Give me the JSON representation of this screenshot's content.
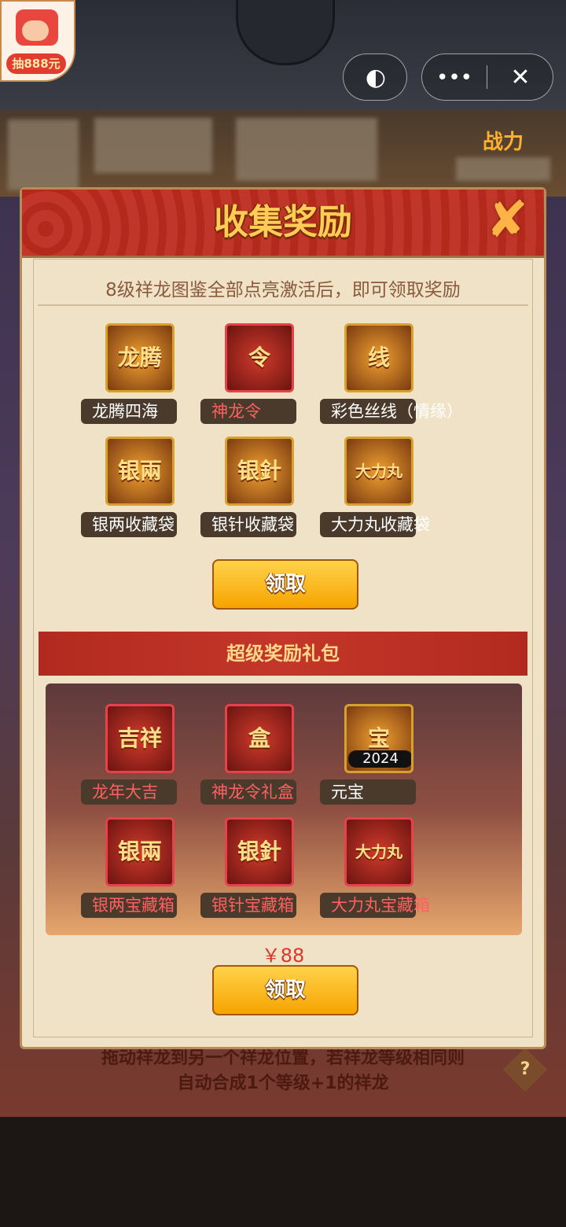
{
  "promo": {
    "label": "抽888元",
    "icon": "gift-hand-icon"
  },
  "capsule": {
    "share_icon": "game-share-icon",
    "more_icon": "more-dots-icon",
    "close_icon": "close-icon"
  },
  "dialog": {
    "title": "收集奖励",
    "close_icon": "dialog-close-x-icon",
    "description": "8级祥龙图鉴全部点亮激活后，即可领取奖励",
    "collect_rewards": [
      {
        "label": "龙腾四海",
        "glyph": "龙腾",
        "frame": "gold",
        "label_color": "white"
      },
      {
        "label": "神龙令",
        "glyph": "令",
        "frame": "red",
        "label_color": "red"
      },
      {
        "label": "彩色丝线（情缘）",
        "glyph": "线",
        "frame": "gold",
        "label_color": "white"
      },
      {
        "label": "银两收藏袋",
        "glyph": "银兩",
        "frame": "gold",
        "label_color": "white"
      },
      {
        "label": "银针收藏袋",
        "glyph": "银針",
        "frame": "gold",
        "label_color": "white"
      },
      {
        "label": "大力丸收藏袋",
        "glyph": "大力丸",
        "frame": "gold",
        "label_color": "white"
      }
    ],
    "claim_button_1": "领取",
    "super_title": "超级奖励礼包",
    "super_rewards": [
      {
        "label": "龙年大吉",
        "glyph": "吉祥",
        "frame": "red",
        "label_color": "red"
      },
      {
        "label": "神龙令礼盒",
        "glyph": "盒",
        "frame": "red",
        "label_color": "red"
      },
      {
        "label": "元宝",
        "glyph": "宝",
        "frame": "gold",
        "label_color": "white",
        "badge": "2024"
      },
      {
        "label": "银两宝藏箱",
        "glyph": "银兩",
        "frame": "red",
        "label_color": "red"
      },
      {
        "label": "银针宝藏箱",
        "glyph": "银針",
        "frame": "red",
        "label_color": "red"
      },
      {
        "label": "大力丸宝藏箱",
        "glyph": "大力丸",
        "frame": "red",
        "label_color": "red"
      }
    ],
    "price": "￥88",
    "claim_button_2": "领取"
  },
  "background": {
    "power_label": "战力",
    "hint_line1": "拖动祥龙到另一个祥龙位置，若祥龙等级相同则",
    "hint_line2": "自动合成1个等级+1的祥龙"
  },
  "colors": {
    "accent_gold": "#ffcd55",
    "header_red": "#c0362a",
    "panel_bg": "#efe2c7"
  }
}
